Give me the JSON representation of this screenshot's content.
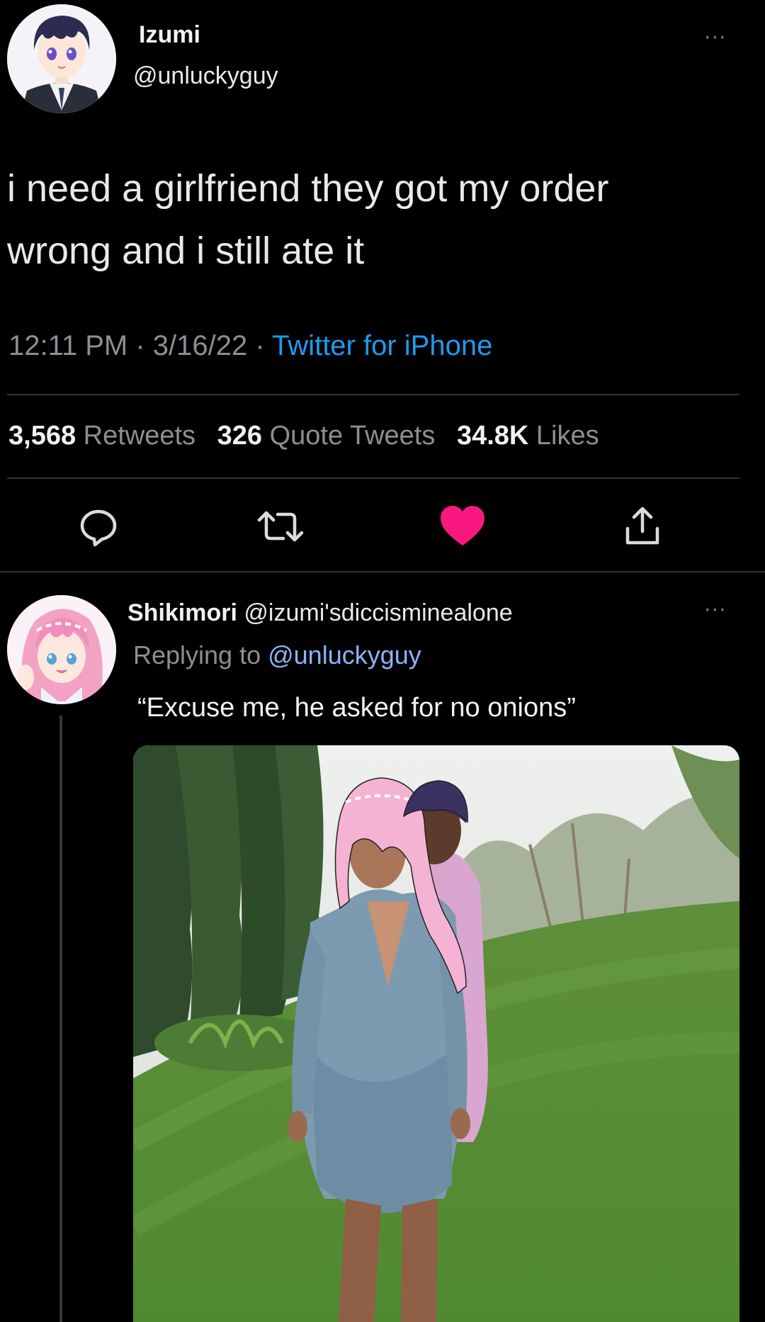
{
  "main_tweet": {
    "author": {
      "name": "Izumi",
      "handle": "@unluckyguy"
    },
    "text_line1": "i need a girlfriend they got my order",
    "text_line2": "wrong and i still ate it",
    "timestamp": "12:11 PM · 3/16/22 · ",
    "source": "Twitter for iPhone",
    "stats": {
      "retweets_count": "3,568",
      "retweets_label": "Retweets",
      "quotes_count": "326",
      "quotes_label": "Quote Tweets",
      "likes_count": "34.8K",
      "likes_label": "Likes"
    },
    "liked": true,
    "more_icon": "···"
  },
  "reply_tweet": {
    "author": {
      "name": "Shikimori",
      "handle": "@izumi'sdiccisminealone"
    },
    "replying_to_label": "Replying to ",
    "replying_to_handle": "@unluckyguy",
    "text": "“Excuse me, he asked for no onions”",
    "more_icon": "···"
  },
  "icons": {
    "reply": "reply-icon",
    "retweet": "retweet-icon",
    "like": "heart-icon",
    "share": "share-icon"
  },
  "colors": {
    "background": "#000000",
    "text": "#e7e9ea",
    "muted": "#8b8f94",
    "link": "#1d9bf0",
    "like": "#f91880",
    "divider": "#2f3336"
  }
}
